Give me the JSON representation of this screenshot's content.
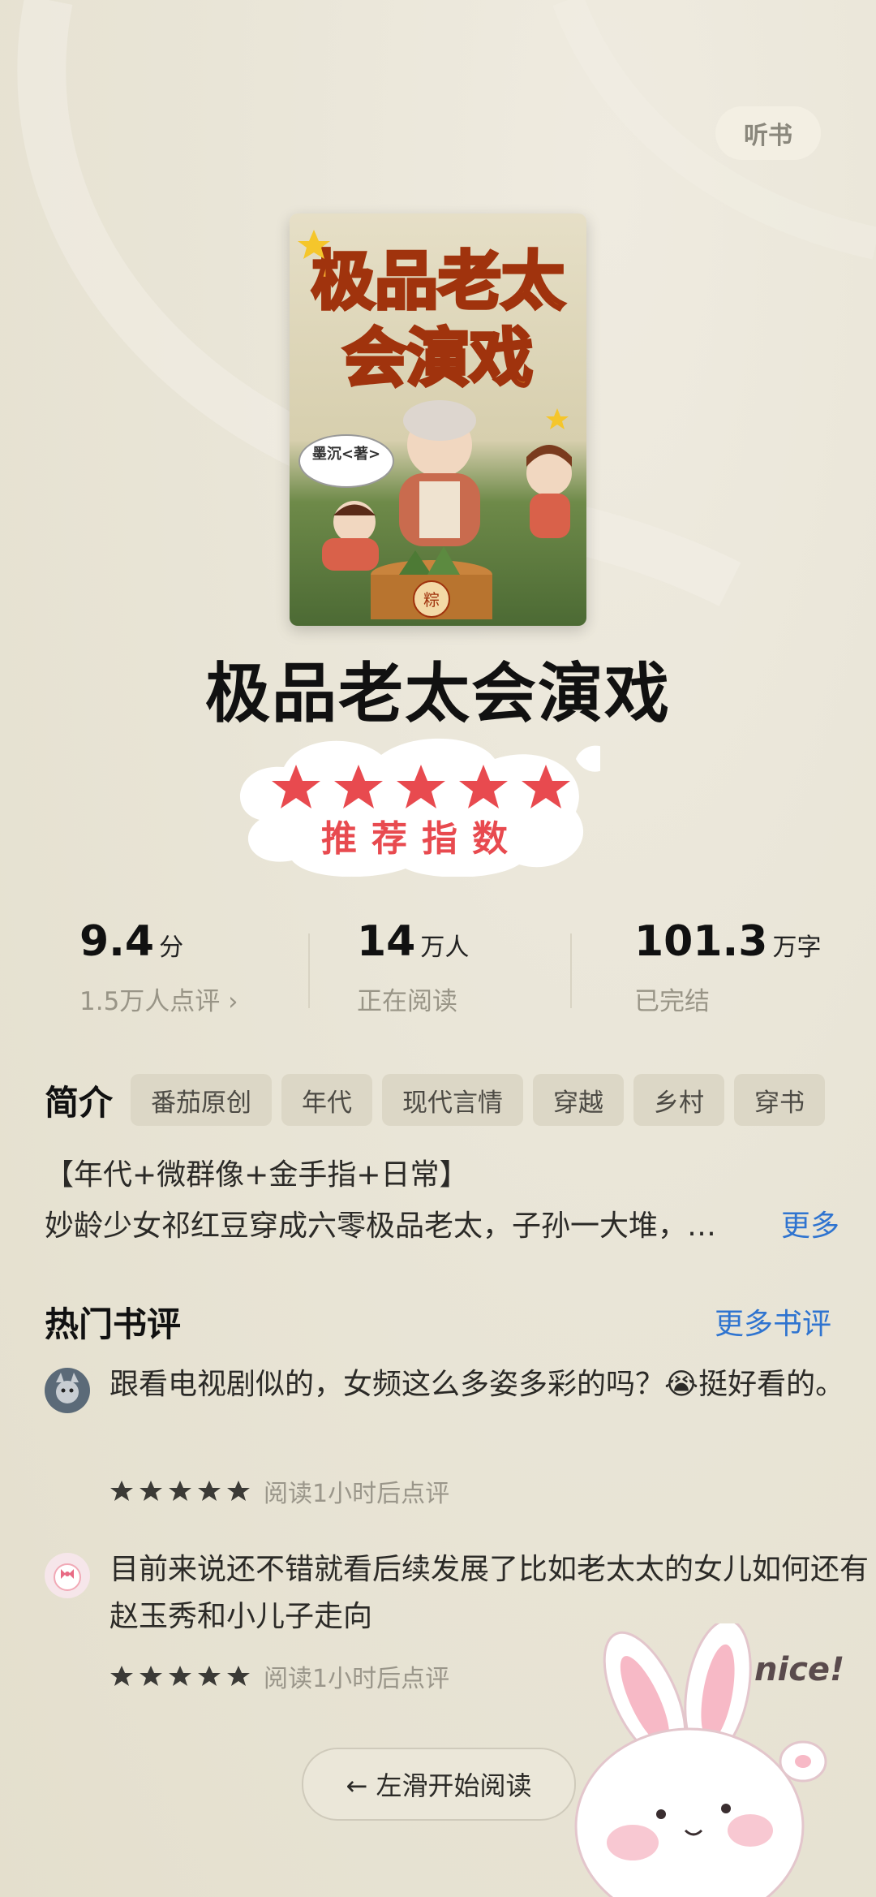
{
  "header": {
    "listen_label": "听书"
  },
  "book": {
    "title": "极品老太会演戏",
    "cover": {
      "title_line1": "极品老太",
      "title_line2": "会演戏",
      "author_badge": "墨沉<著>",
      "basket_label": "粽"
    }
  },
  "badge": {
    "stars": 5,
    "label": "推荐指数"
  },
  "stats": [
    {
      "value": "9.4",
      "unit": "分",
      "label": "1.5万人点评 ›"
    },
    {
      "value": "14",
      "unit": "万人",
      "label": "正在阅读"
    },
    {
      "value": "101.3",
      "unit": "万字",
      "label": "已完结"
    }
  ],
  "intro": {
    "label": "简介",
    "tags": [
      "番茄原创",
      "年代",
      "现代言情",
      "穿越",
      "乡村",
      "穿书"
    ],
    "line1": "【年代+微群像+金手指+日常】",
    "line2": "妙龄少女祁红豆穿成六零极品老太，子孙一大堆，…",
    "more": "更多"
  },
  "reviews_section": {
    "title": "热门书评",
    "more": "更多书评"
  },
  "reviews": [
    {
      "text": "跟看电视剧似的，女频这么多姿多彩的吗？😭挺好看的。",
      "stars": 5,
      "meta": "阅读1小时后点评"
    },
    {
      "text": "目前来说还不错就看后续发展了比如老太太的女儿如何还有赵玉秀和小儿子走向",
      "stars": 5,
      "meta": "阅读1小时后点评"
    }
  ],
  "start_button": {
    "label": "← 左滑开始阅读"
  },
  "sticker": {
    "text": "nice!"
  },
  "colors": {
    "accent_blue": "#2f74d0",
    "star_red": "#e84a4f",
    "background": "#e9e5d7"
  }
}
